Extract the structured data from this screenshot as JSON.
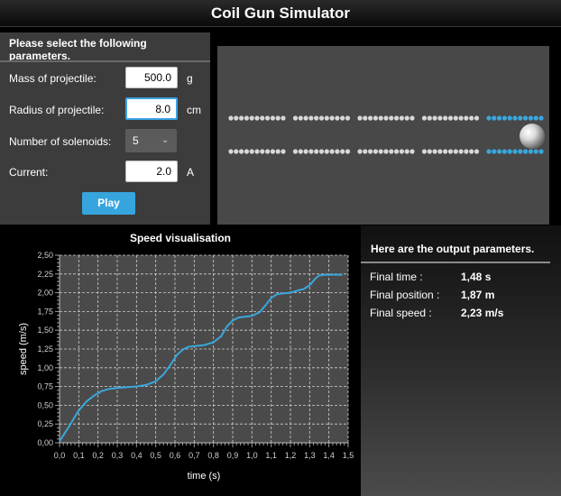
{
  "app": {
    "title": "Coil Gun Simulator"
  },
  "params": {
    "title": "Please select the following parameters.",
    "mass": {
      "label": "Mass of projectile:",
      "value": "500.0",
      "unit": "g"
    },
    "radius": {
      "label": "Radius of projectile:",
      "value": "8.0",
      "unit": "cm"
    },
    "solenoids": {
      "label": "Number of solenoids:",
      "value": "5"
    },
    "current": {
      "label": "Current:",
      "value": "2.0",
      "unit": "A"
    },
    "play_label": "Play"
  },
  "simulation": {
    "solenoid_count": 5,
    "active_solenoid": 5,
    "colors": {
      "inactive": "#d8d8d8",
      "active": "#3aa7dd"
    }
  },
  "output": {
    "title": "Here are the output parameters.",
    "final_time": {
      "label": "Final time :",
      "value": "1,48 s"
    },
    "final_position": {
      "label": "Final position :",
      "value": "1,87 m"
    },
    "final_speed": {
      "label": "Final speed :",
      "value": "2,23 m/s"
    }
  },
  "chart_data": {
    "type": "line",
    "title": "Speed visualisation",
    "xlabel": "time (s)",
    "ylabel": "speed (m/s)",
    "xlim": [
      0,
      1.5
    ],
    "ylim": [
      0,
      2.5
    ],
    "x_ticks": [
      "0,0",
      "0,1",
      "0,2",
      "0,3",
      "0,4",
      "0,5",
      "0,6",
      "0,7",
      "0,8",
      "0,9",
      "1,0",
      "1,1",
      "1,2",
      "1,3",
      "1,4",
      "1,5"
    ],
    "y_ticks": [
      "0,00",
      "0,25",
      "0,50",
      "0,75",
      "1,00",
      "1,25",
      "1,50",
      "1,75",
      "2,00",
      "2,25",
      "2,50"
    ],
    "grid": true,
    "line_color": "#3aa7dd",
    "series": [
      {
        "x": [
          0.0,
          0.02,
          0.05,
          0.08,
          0.1,
          0.14,
          0.18,
          0.22,
          0.26,
          0.3,
          0.35,
          0.4,
          0.45,
          0.5,
          0.54,
          0.58,
          0.61,
          0.64,
          0.67,
          0.7,
          0.75,
          0.8,
          0.84,
          0.87,
          0.9,
          0.93,
          0.96,
          1.0,
          1.04,
          1.07,
          1.1,
          1.13,
          1.16,
          1.2,
          1.24,
          1.27,
          1.3,
          1.33,
          1.35,
          1.38,
          1.42,
          1.47
        ],
        "y": [
          0.02,
          0.1,
          0.22,
          0.35,
          0.43,
          0.55,
          0.63,
          0.69,
          0.72,
          0.73,
          0.74,
          0.75,
          0.77,
          0.82,
          0.91,
          1.05,
          1.17,
          1.24,
          1.28,
          1.29,
          1.3,
          1.34,
          1.42,
          1.55,
          1.63,
          1.67,
          1.68,
          1.69,
          1.74,
          1.83,
          1.93,
          1.98,
          1.99,
          2.0,
          2.03,
          2.05,
          2.1,
          2.19,
          2.23,
          2.24,
          2.24,
          2.24
        ]
      }
    ]
  }
}
